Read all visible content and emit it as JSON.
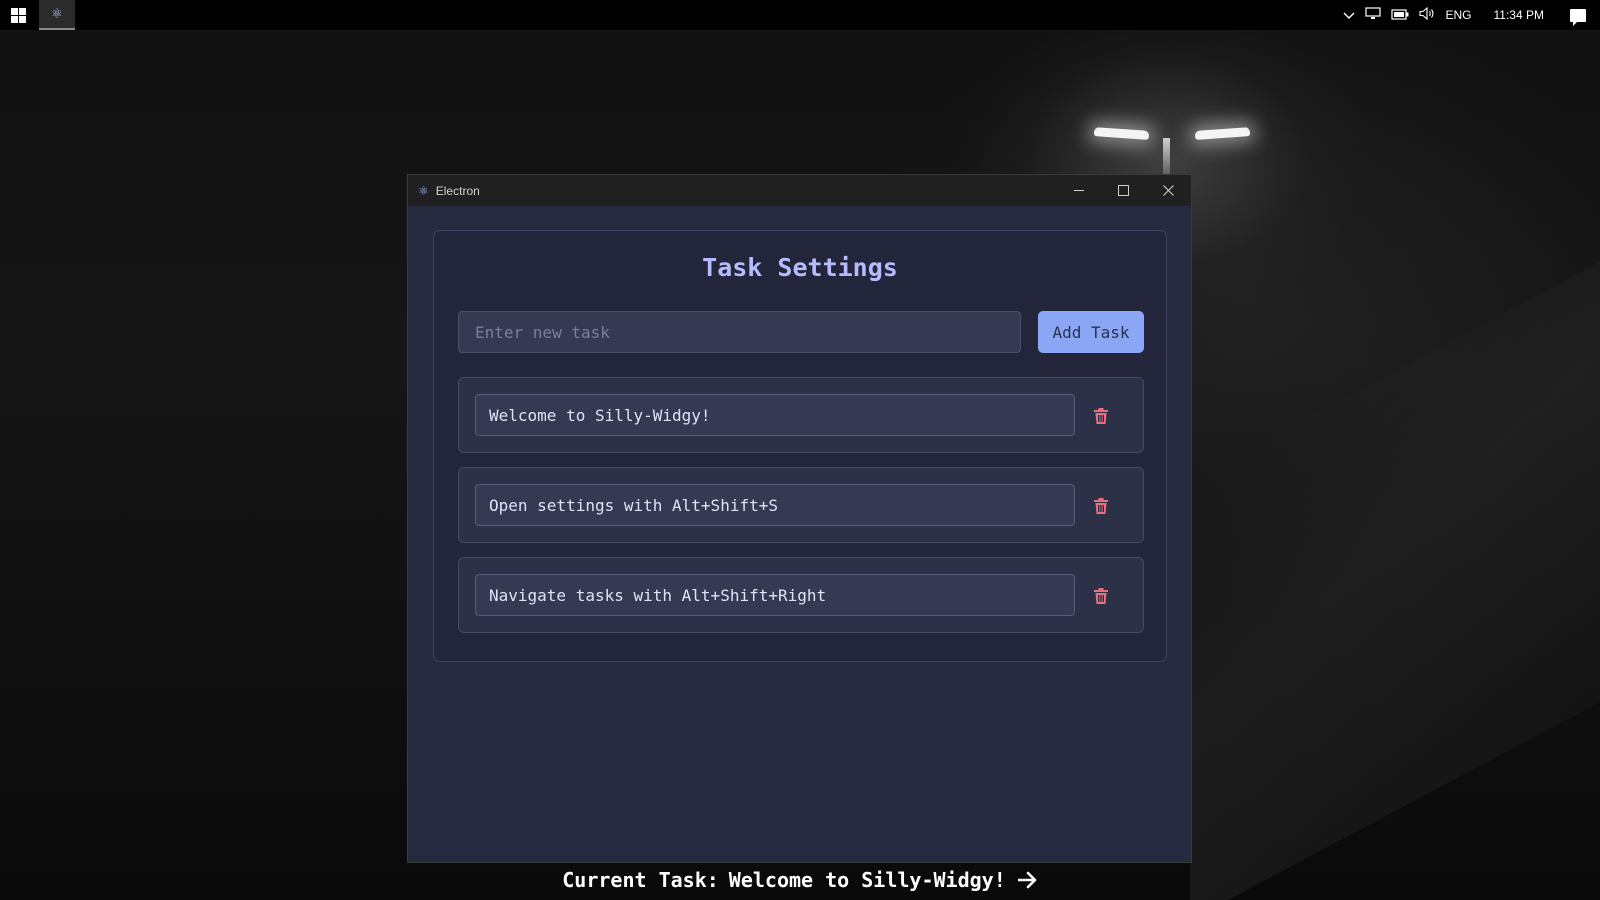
{
  "taskbar": {
    "language": "ENG",
    "time": "11:34 PM",
    "icons": [
      "windows-start-icon",
      "electron-app-icon",
      "chevron-up-icon",
      "network-icon",
      "battery-icon",
      "volume-icon",
      "notification-icon"
    ]
  },
  "window": {
    "title": "Electron",
    "controls": [
      "minimize",
      "maximize",
      "close"
    ]
  },
  "settings": {
    "heading": "Task Settings",
    "new_task_placeholder": "Enter new task",
    "new_task_value": "",
    "add_button": "Add Task",
    "tasks": [
      {
        "text": "Welcome to Silly-Widgy!"
      },
      {
        "text": "Open settings with Alt+Shift+S"
      },
      {
        "text": "Navigate tasks with Alt+Shift+Right"
      }
    ]
  },
  "current_task": {
    "prefix": "Current Task:",
    "text": "Welcome to Silly-Widgy!"
  },
  "colors": {
    "accent": "#8aa6f5",
    "heading": "#b4bcff",
    "delete": "#e8707f",
    "window_bg": "#262a3f"
  }
}
